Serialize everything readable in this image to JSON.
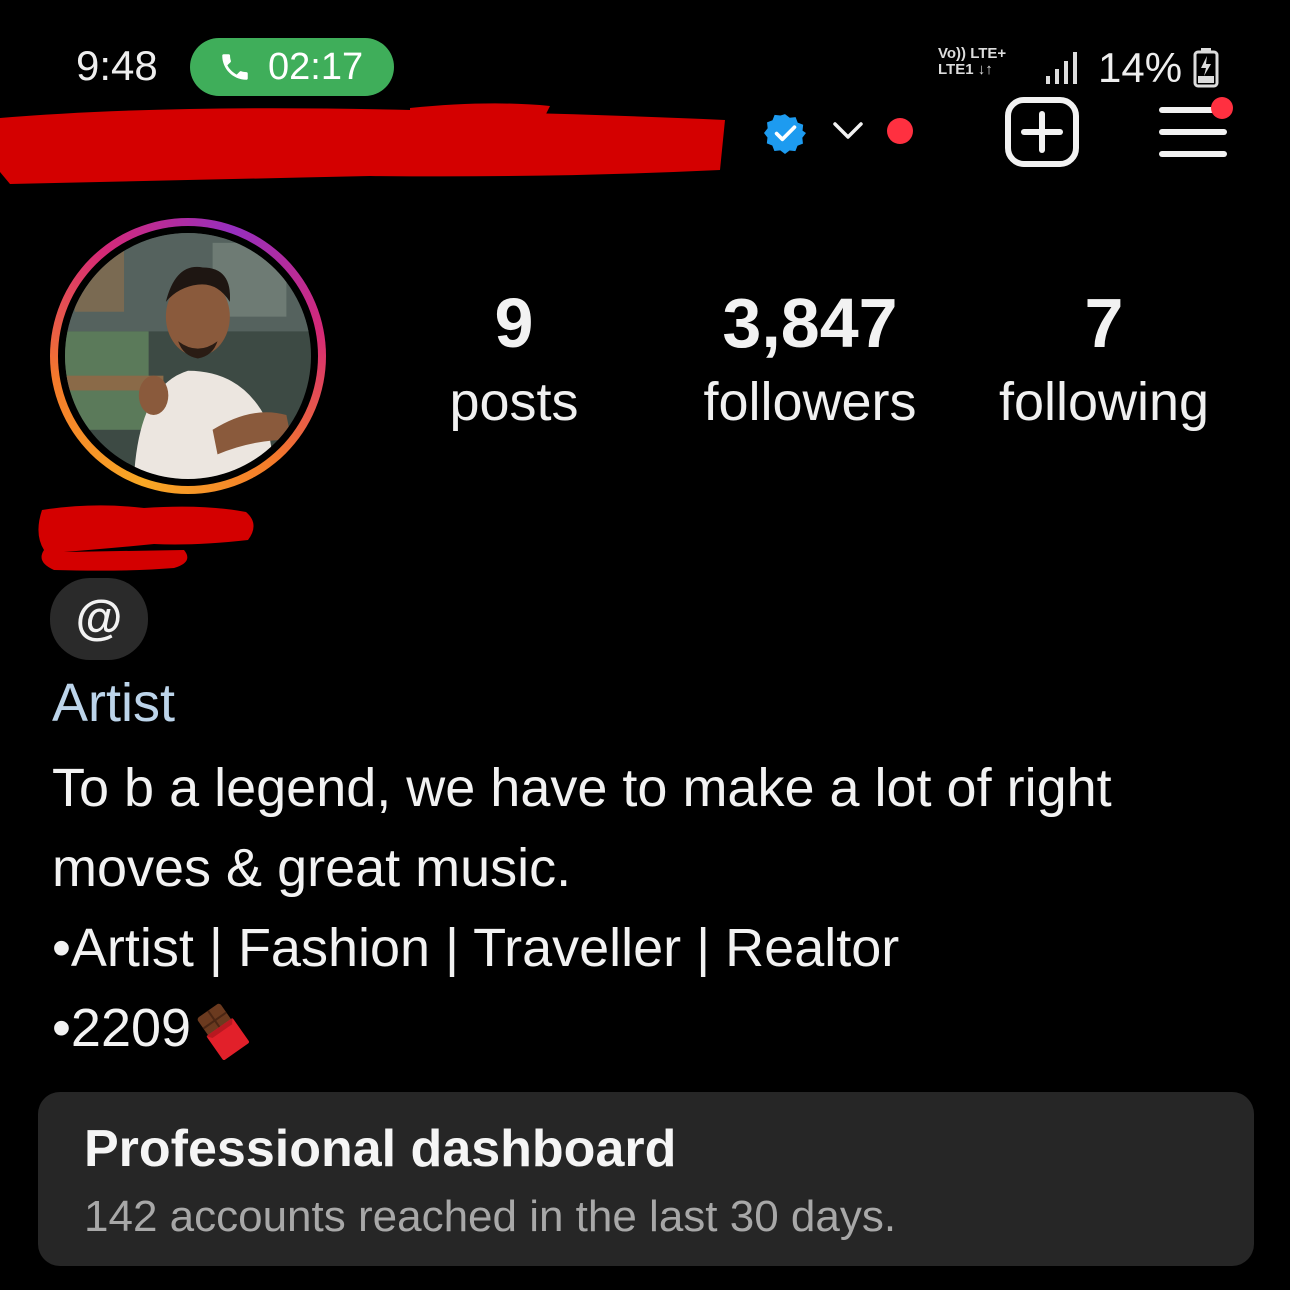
{
  "status_bar": {
    "time": "9:48",
    "call_duration": "02:17",
    "network_line1": "Vo)) LTE+",
    "network_line2": "LTE1 ↓↑",
    "battery": "14%"
  },
  "header": {
    "icons": [
      "verified-badge-icon",
      "chevron-down-icon",
      "notification-dot",
      "create-plus-icon",
      "menu-icon"
    ]
  },
  "profile": {
    "stats": [
      {
        "value": "9",
        "label": "posts"
      },
      {
        "value": "3,847",
        "label": "followers"
      },
      {
        "value": "7",
        "label": "following"
      }
    ],
    "threads_glyph": "@",
    "category": "Artist",
    "bio_lines": [
      "To b a legend, we have to make a lot of right",
      "moves & great music.",
      "•Artist | Fashion | Traveller | Realtor",
      "•2209"
    ]
  },
  "dashboard": {
    "title": "Professional dashboard",
    "subtitle": "142 accounts reached in the last 30 days."
  },
  "colors": {
    "call_pill": "#3fae5a",
    "verified": "#1d9bf0",
    "notification": "#ff3040",
    "redaction": "#d40000",
    "category_text": "#bcd4ea"
  }
}
